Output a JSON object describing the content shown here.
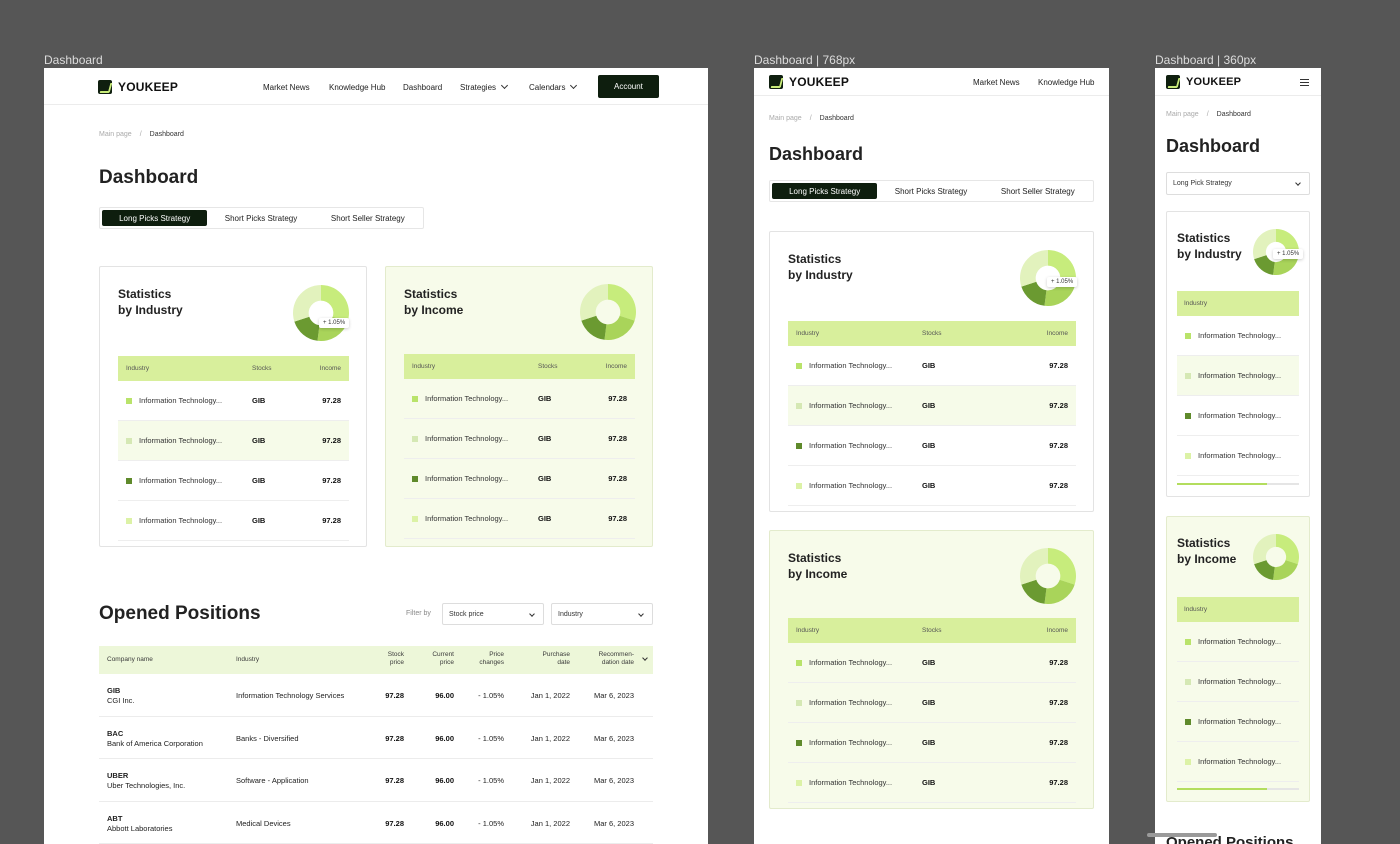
{
  "frames": {
    "desktop_label": "Dashboard",
    "tablet_label": "Dashboard | 768px",
    "mobile_label": "Dashboard | 360px"
  },
  "brand": {
    "name": "YOUKEEP"
  },
  "nav": {
    "market_news": "Market News",
    "knowledge_hub": "Knowledge Hub",
    "dashboard": "Dashboard",
    "strategies": "Strategies",
    "calendars": "Calendars",
    "account": "Account"
  },
  "breadcrumb": {
    "home": "Main page",
    "sep": "/",
    "current": "Dashboard"
  },
  "page_title": "Dashboard",
  "tabs": [
    "Long Picks Strategy",
    "Short Picks Strategy",
    "Short Seller Strategy"
  ],
  "mobile_select": "Long Pick Strategy",
  "stats_industry": {
    "title_l1": "Statistics",
    "title_l2": "by Industry",
    "badge": "+ 1.05%",
    "head": {
      "industry": "Industry",
      "stocks": "Stocks",
      "income": "Income"
    },
    "rows": [
      {
        "industry": "Information Technology...",
        "stock": "GIB",
        "income": "97.28",
        "color": "#b9e36a"
      },
      {
        "industry": "Information Technology...",
        "stock": "GIB",
        "income": "97.28",
        "color": "#d5e8b4"
      },
      {
        "industry": "Information Technology...",
        "stock": "GIB",
        "income": "97.28",
        "color": "#5f8a2b"
      },
      {
        "industry": "Information Technology...",
        "stock": "GIB",
        "income": "97.28",
        "color": "#dcf2a6"
      }
    ]
  },
  "stats_income": {
    "title_l1": "Statistics",
    "title_l2": "by Income",
    "head": {
      "industry": "Industry",
      "stocks": "Stocks",
      "income": "Income"
    },
    "rows": [
      {
        "industry": "Information Technology...",
        "stock": "GIB",
        "income": "97.28",
        "color": "#b9e36a"
      },
      {
        "industry": "Information Technology...",
        "stock": "GIB",
        "income": "97.28",
        "color": "#d5e8b4"
      },
      {
        "industry": "Information Technology...",
        "stock": "GIB",
        "income": "97.28",
        "color": "#5f8a2b"
      },
      {
        "industry": "Information Technology...",
        "stock": "GIB",
        "income": "97.28",
        "color": "#dcf2a6"
      }
    ]
  },
  "positions": {
    "title": "Opened Positions",
    "mobile_title": "Opened Positions",
    "filter_label": "Filter by",
    "filter_stock": "Stock price",
    "filter_industry": "Industry",
    "headers": {
      "company": "Company name",
      "industry": "Industry",
      "stock_l1": "Stock",
      "stock_l2": "price",
      "current_l1": "Current",
      "current_l2": "price",
      "change_l1": "Price",
      "change_l2": "changes",
      "purchase_l1": "Purchase",
      "purchase_l2": "date",
      "rec_l1": "Recommen-",
      "rec_l2": "dation date"
    },
    "rows": [
      {
        "symbol": "GIB",
        "company": "CGI Inc.",
        "industry": "Information Technology Services",
        "stock": "97.28",
        "current": "96.00",
        "change": "- 1.05%",
        "purchase": "Jan 1, 2022",
        "rec": "Mar 6, 2023"
      },
      {
        "symbol": "BAC",
        "company": "Bank of America Corporation",
        "industry": "Banks - Diversified",
        "stock": "97.28",
        "current": "96.00",
        "change": "- 1.05%",
        "purchase": "Jan 1, 2022",
        "rec": "Mar 6, 2023"
      },
      {
        "symbol": "UBER",
        "company": "Uber Technologies, Inc.",
        "industry": "Software - Application",
        "stock": "97.28",
        "current": "96.00",
        "change": "- 1.05%",
        "purchase": "Jan 1, 2022",
        "rec": "Mar 6, 2023"
      },
      {
        "symbol": "ABT",
        "company": "Abbott Laboratories",
        "industry": "Medical Devices",
        "stock": "97.28",
        "current": "96.00",
        "change": "- 1.05%",
        "purchase": "Jan 1, 2022",
        "rec": "Mar 6, 2023"
      }
    ]
  },
  "donut_segments": [
    {
      "name": "segment-1",
      "share": 0.3,
      "color": "#c7ec7c"
    },
    {
      "name": "segment-2",
      "share": 0.22,
      "color": "#a9d45a"
    },
    {
      "name": "segment-3",
      "share": 0.18,
      "color": "#6b9a31"
    },
    {
      "name": "segment-4",
      "share": 0.3,
      "color": "#e2f2bd"
    }
  ]
}
